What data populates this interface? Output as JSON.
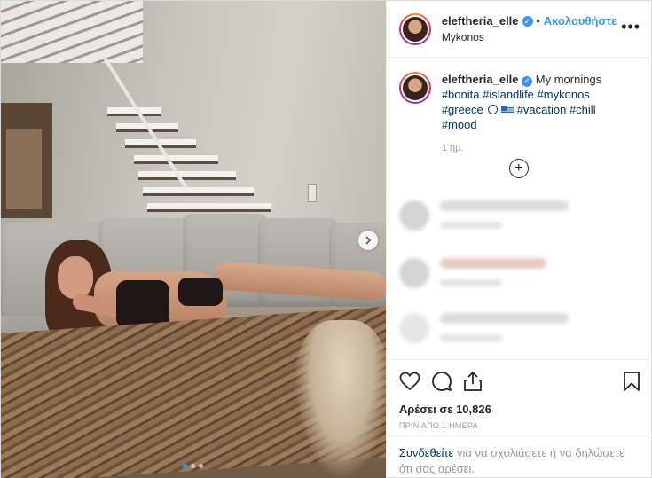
{
  "header": {
    "username": "eleftheria_elle",
    "follow_label": "Ακολουθήστε",
    "location": "Mykonos",
    "separator": "•",
    "more_glyph": "•••"
  },
  "caption": {
    "username": "eleftheria_elle",
    "text": "My mornings",
    "hashtags": [
      "#bonita",
      "#islandlife",
      "#mykonos",
      "#greece",
      "#vacation",
      "#chill",
      "#mood"
    ],
    "time_ago": "1 ημ."
  },
  "photo": {
    "carousel_dots": 3,
    "active_dot": 0
  },
  "actions": {
    "likes": "Αρέσει σε 10,826",
    "posted": "ΠΡΙΝ ΑΠΟ 1 ΗΜΕΡΑ"
  },
  "login_prompt": {
    "link": "Συνδεθείτε",
    "rest": " για να σχολιάσετε ή να δηλώσετε ότι σας αρέσει."
  },
  "icons": {
    "verified": "verified-badge-icon",
    "like": "heart-icon",
    "comment": "comment-icon",
    "share": "share-icon",
    "save": "bookmark-icon",
    "load_more": "plus-circle-icon",
    "next": "chevron-right-icon"
  },
  "colors": {
    "accent": "#3897f0",
    "hashtag": "#003569",
    "muted": "#999999"
  }
}
